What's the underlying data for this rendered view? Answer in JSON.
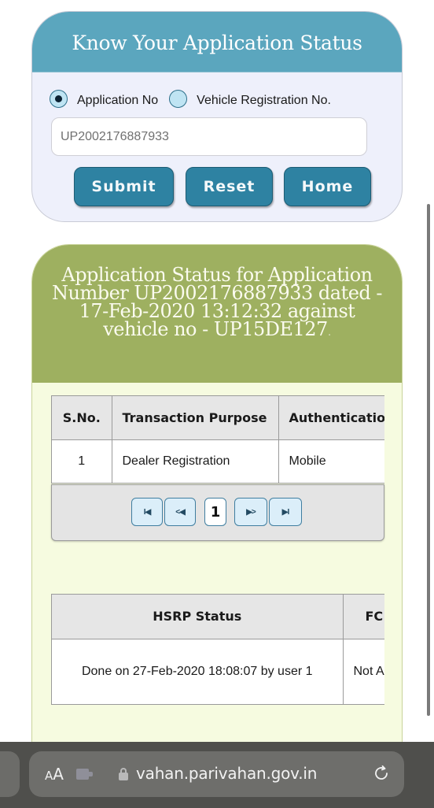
{
  "search_form": {
    "title": "Know Your Application Status",
    "radio_options": [
      {
        "label": "Application No",
        "selected": true
      },
      {
        "label": "Vehicle Registration No.",
        "selected": false
      }
    ],
    "application_input_value": "UP2002176887933",
    "buttons": {
      "submit": "Submit",
      "reset": "Reset",
      "home": "Home"
    }
  },
  "status_panel": {
    "title": "Application Status for Application Number UP2002176887933   dated - 17-Feb-2020 13:12:32 against vehicle no - UP15DE127",
    "title_tail": ".",
    "transactions_table": {
      "columns": [
        "S.No.",
        "Transaction Purpose",
        "Authentication"
      ],
      "rows": [
        [
          "1",
          "Dealer Registration",
          "Mobile"
        ]
      ]
    },
    "pager": {
      "first": "I◀",
      "prev": "<◀",
      "current_page": "1",
      "next": "▶>",
      "last": "▶I"
    },
    "hsrp_table": {
      "columns": [
        "HSRP Status",
        "FC"
      ],
      "rows": [
        [
          "Done on 27-Feb-2020 18:08:07 by user 1",
          "Not A"
        ]
      ]
    }
  },
  "browser": {
    "text_size_label_small": "A",
    "text_size_label_large": "A",
    "url": "vahan.parivahan.gov.in",
    "icons": [
      "text-size-icon",
      "extension-icon",
      "lock-icon",
      "reload-icon"
    ]
  },
  "colors": {
    "form_header": "#5ba6be",
    "button": "#2e82a2",
    "status_header": "#9eb060",
    "status_body": "#f6fbe0"
  }
}
